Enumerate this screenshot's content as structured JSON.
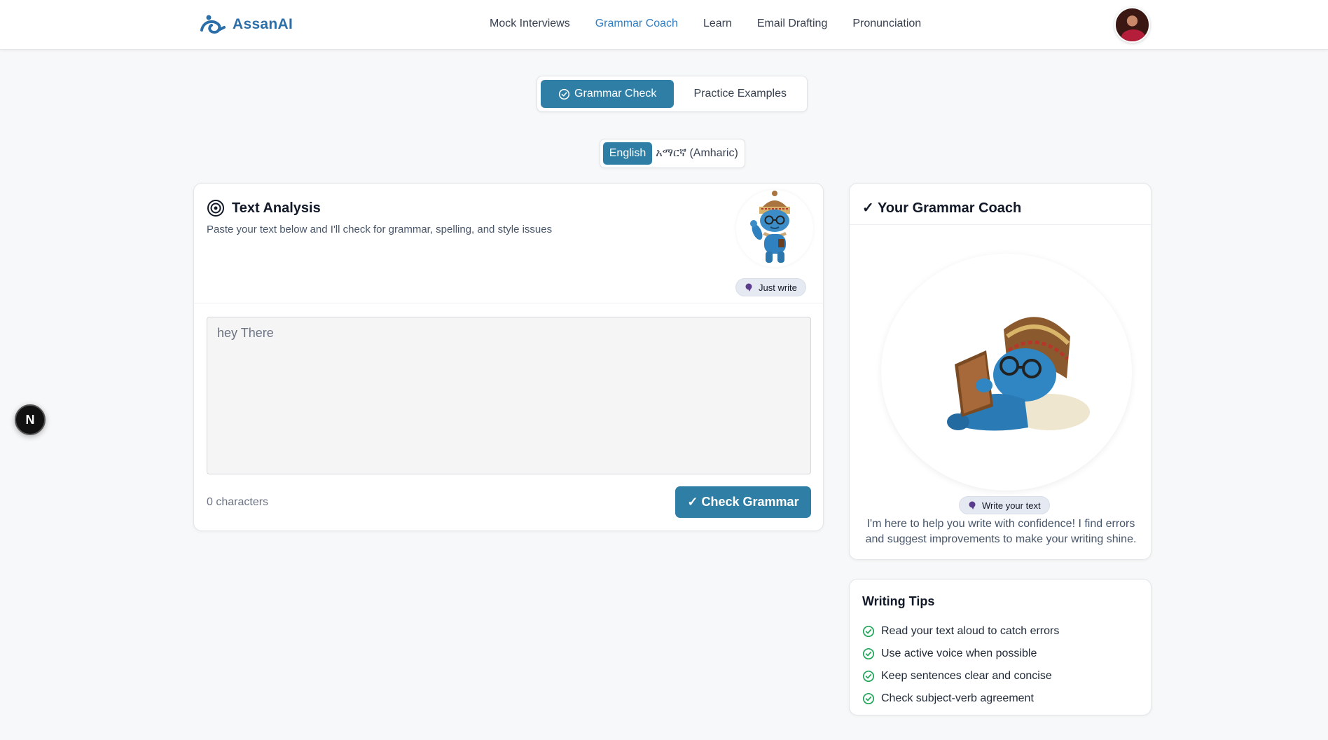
{
  "brand": {
    "name": "AssanAI"
  },
  "nav": {
    "items": [
      {
        "label": "Mock Interviews"
      },
      {
        "label": "Grammar Coach"
      },
      {
        "label": "Learn"
      },
      {
        "label": "Email Drafting"
      },
      {
        "label": "Pronunciation"
      }
    ],
    "active_index": 1
  },
  "mode_tabs": [
    {
      "label": "Grammar Check",
      "icon": "check-circle-icon"
    },
    {
      "label": "Practice Examples"
    }
  ],
  "language": {
    "options": [
      "English",
      "አማርኛ (Amharic)"
    ],
    "selected": "English"
  },
  "text_analysis": {
    "title": "Text Analysis",
    "subtitle": "Paste your text below and I'll check for grammar, spelling, and style issues",
    "mascot_badge": "Just write",
    "input_value": "hey There",
    "char_count": "0 characters",
    "check_button": "✓ Check Grammar"
  },
  "coach": {
    "title": "✓ Your Grammar Coach",
    "badge": "Write your text",
    "description": "I'm here to help you write with confidence! I find errors and suggest improvements to make your writing shine."
  },
  "tips": {
    "title": "Writing Tips",
    "items": [
      "Read your text aloud to catch errors",
      "Use active voice when possible",
      "Keep sentences clear and concise",
      "Check subject-verb agreement"
    ]
  },
  "dev_badge": {
    "label": "N"
  },
  "colors": {
    "primary": "#2f7ea5",
    "nav_active": "#2e7ec4",
    "tip_check": "#22a55a"
  }
}
